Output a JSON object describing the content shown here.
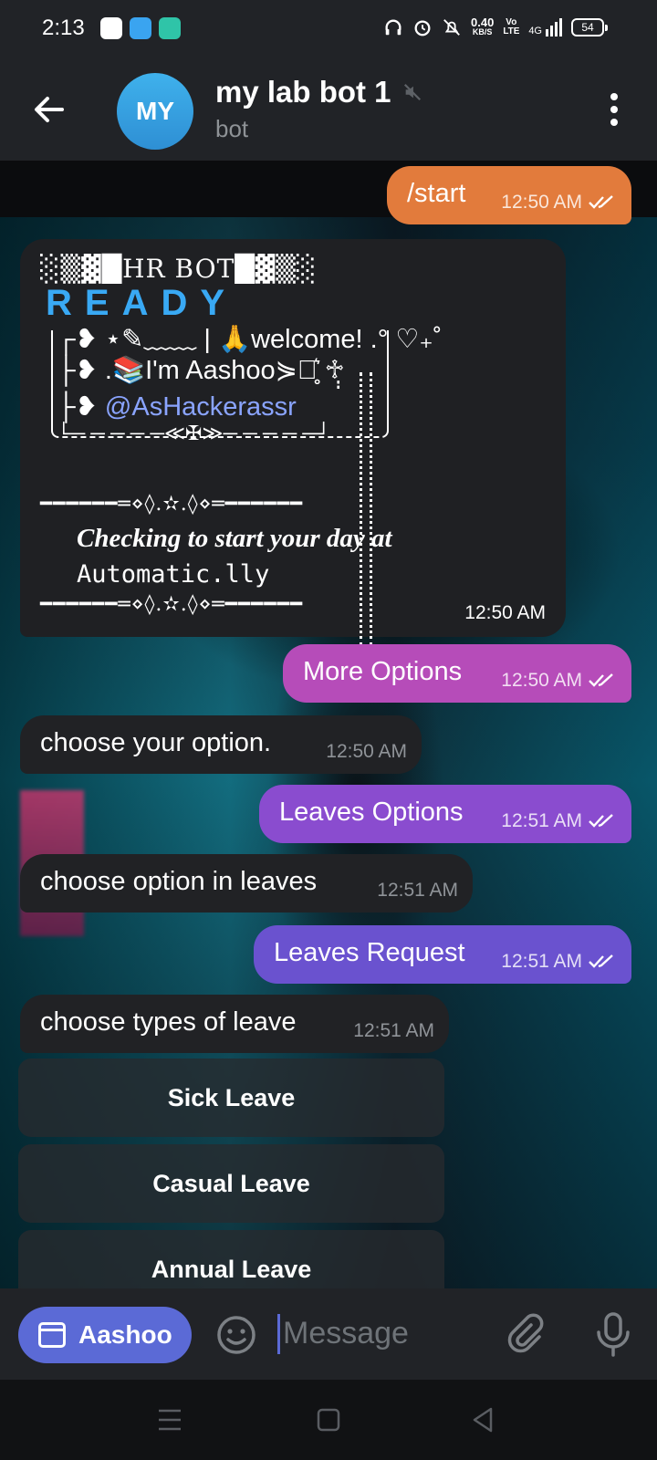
{
  "status_bar": {
    "time": "2:13",
    "net_speed": "0.40",
    "net_unit": "KB/S",
    "volte": "Vo LTE",
    "network": "4G",
    "battery": "54"
  },
  "header": {
    "avatar_initials": "MY",
    "title": "my lab bot 1",
    "subtitle": "bot",
    "muted": true
  },
  "messages": [
    {
      "dir": "out",
      "text": "/start",
      "time": "12:50 AM",
      "read": true,
      "color": "#e27b3c"
    },
    {
      "dir": "in",
      "type": "card",
      "time": "12:50 AM",
      "card": {
        "header": "░▒▓█HR BOT█▓▒░",
        "ready": "READY",
        "line1": "┌❥ ⋆✎﹏﹏ | 🙏welcome! .° ♡₊˚",
        "line2": "├❥ .📚I'm Aashoo⋟⋆̥̥͛ ♱̣̣",
        "line3": "├❥ ",
        "handle": "@AsHackerassr",
        "line4": "└─ ─ ─ ─ ─≪✠≫─ ─ ─ ─ ─┘",
        "rule": "━━━━━━═⋄◊.✫.◊⋄═━━━━━━",
        "checking": "Checking to start your day at",
        "automatic": "Automatic.lly"
      }
    },
    {
      "dir": "out",
      "text": "More Options",
      "time": "12:50 AM",
      "read": true,
      "color": "#b64cb9"
    },
    {
      "dir": "in",
      "text": "choose your option.",
      "time": "12:50 AM"
    },
    {
      "dir": "out",
      "text": "Leaves Options",
      "time": "12:51 AM",
      "read": true,
      "color": "#8a4ccf"
    },
    {
      "dir": "in",
      "text": "choose option in leaves",
      "time": "12:51 AM"
    },
    {
      "dir": "out",
      "text": "Leaves Request",
      "time": "12:51 AM",
      "read": true,
      "color": "#6a52cf"
    },
    {
      "dir": "in",
      "text": "choose types of leave",
      "time": "12:51 AM"
    }
  ],
  "keyboard": [
    "Sick Leave",
    "Casual Leave",
    "Annual Leave"
  ],
  "input": {
    "bot_button": "Aashoo",
    "placeholder": "Message"
  },
  "icons": {
    "back": "arrow-left-icon",
    "mute": "muted-speaker-icon",
    "menu": "kebab-menu-icon",
    "emoji": "smiley-icon",
    "attach": "paperclip-icon",
    "mic": "microphone-icon",
    "read": "double-check-icon"
  }
}
